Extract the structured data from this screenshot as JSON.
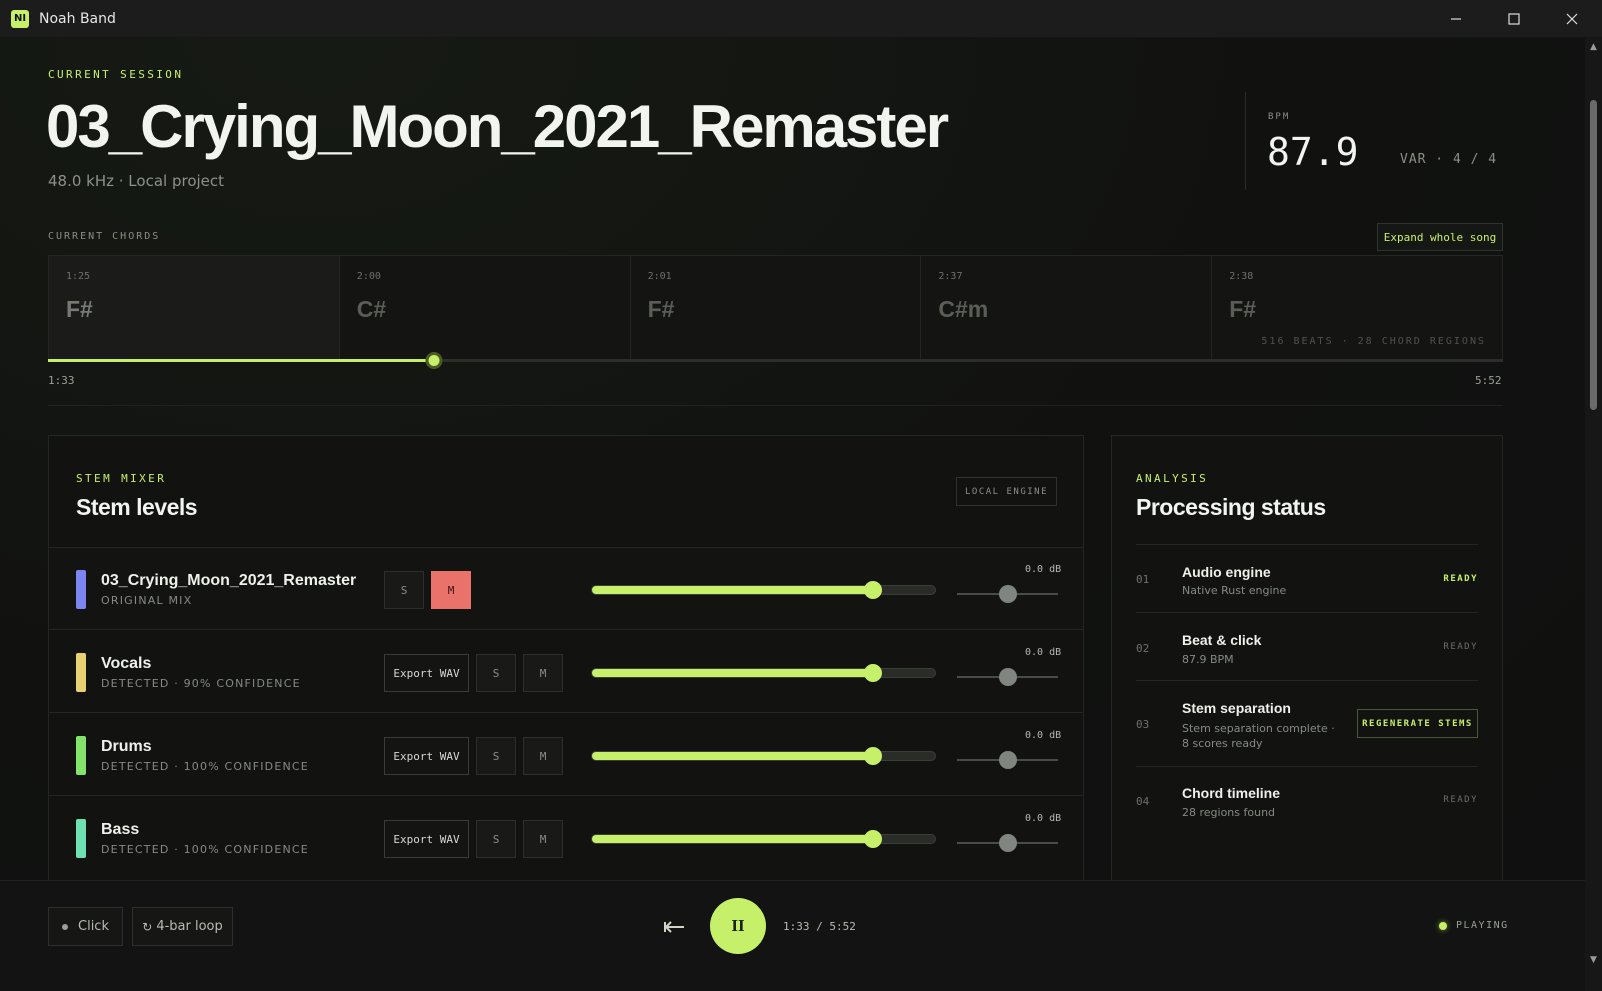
{
  "window": {
    "title": "Noah Band",
    "icon_label": "NI"
  },
  "session": {
    "eyebrow": "CURRENT SESSION",
    "title": "03_Crying_Moon_2021_Remaster",
    "subtitle": "48.0 kHz · Local project",
    "bpm_label": "BPM",
    "bpm_value": "87.9",
    "meter": "VAR · 4 / 4"
  },
  "chords": {
    "label": "CURRENT CHORDS",
    "expand_label": "Expand whole song",
    "items": [
      {
        "time": "1:25",
        "name": "F#"
      },
      {
        "time": "2:00",
        "name": "C#"
      },
      {
        "time": "2:01",
        "name": "F#"
      },
      {
        "time": "2:37",
        "name": "C#m"
      },
      {
        "time": "2:38",
        "name": "F#"
      }
    ],
    "meta": "516 BEATS · 28 CHORD REGIONS",
    "progress_fraction": 0.2656,
    "time_current": "1:33",
    "time_total": "5:52"
  },
  "mixer": {
    "eyebrow": "STEM MIXER",
    "title": "Stem levels",
    "engine_badge": "LOCAL ENGINE",
    "export_label": "Export WAV",
    "solo_label": "S",
    "mute_label": "M",
    "stems": [
      {
        "name": "03_Crying_Moon_2021_Remaster",
        "sub": "ORIGINAL MIX",
        "color": "#7b86f2",
        "db": "0.0 dB",
        "volume": 0.82,
        "pan": 0.5,
        "muted": true
      },
      {
        "name": "Vocals",
        "sub": "DETECTED · 90% CONFIDENCE",
        "color": "#e8d170",
        "db": "0.0 dB",
        "volume": 0.82,
        "pan": 0.5,
        "muted": false
      },
      {
        "name": "Drums",
        "sub": "DETECTED · 100% CONFIDENCE",
        "color": "#84e36a",
        "db": "0.0 dB",
        "volume": 0.82,
        "pan": 0.5,
        "muted": false
      },
      {
        "name": "Bass",
        "sub": "DETECTED · 100% CONFIDENCE",
        "color": "#6fe0b2",
        "db": "0.0 dB",
        "volume": 0.82,
        "pan": 0.5,
        "muted": false
      }
    ]
  },
  "analysis": {
    "eyebrow": "ANALYSIS",
    "title": "Processing status",
    "items": [
      {
        "num": "01",
        "title": "Audio engine",
        "desc": "Native Rust engine",
        "tag": "READY"
      },
      {
        "num": "02",
        "title": "Beat & click",
        "desc": "87.9 BPM",
        "tag": "READY"
      },
      {
        "num": "03",
        "title": "Stem separation",
        "desc": "Stem separation complete · 8 scores ready",
        "action": "REGENERATE STEMS"
      },
      {
        "num": "04",
        "title": "Chord timeline",
        "desc": "28 regions found",
        "tag": "READY"
      }
    ]
  },
  "transport": {
    "click_label": "Click",
    "loop_label": "4-bar loop",
    "pause_glyph": "II",
    "time": "1:33 / 5:52",
    "status": "PLAYING"
  },
  "colors": {
    "accent": "#c7f06a",
    "mute_active": "#e9726a"
  }
}
